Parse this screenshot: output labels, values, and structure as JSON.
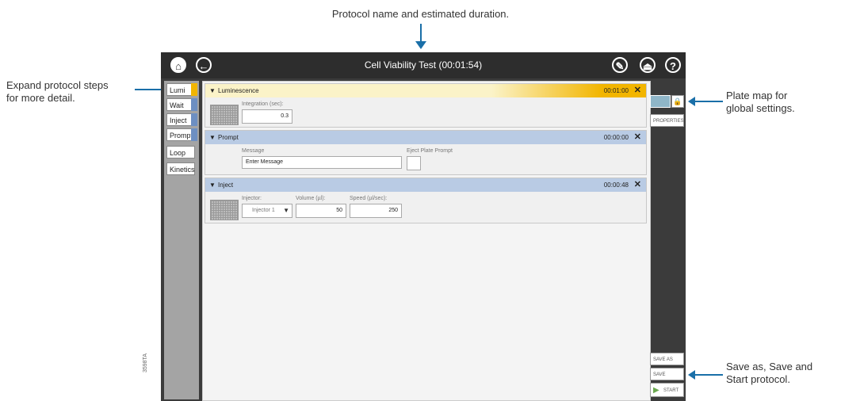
{
  "callouts": {
    "top": "Protocol name and estimated duration.",
    "left": "Expand protocol steps\nfor more detail.",
    "plate_map": "Plate map for\nglobal settings.",
    "save": "Save as, Save and\nStart protocol.",
    "figure_id": "3598TA"
  },
  "topbar": {
    "title": "Cell Viability Test (00:01:54)",
    "buttons": [
      "home-icon",
      "back-icon",
      "wrench-icon",
      "eject-icon",
      "help-icon"
    ]
  },
  "step_tabs": [
    "Lumi",
    "Wait",
    "Inject",
    "Prompt",
    "Loop",
    "Kinetics"
  ],
  "panels": {
    "luminescence": {
      "name": "Luminescence",
      "time": "00:01:00",
      "field_label": "Integration (sec):",
      "field_value": "0.3"
    },
    "prompt": {
      "name": "Prompt",
      "time": "00:00:00",
      "message_label": "Message",
      "message_value": "Enter Message",
      "eject_label": "Eject Plate Prompt"
    },
    "inject": {
      "name": "Inject",
      "time": "00:00:48",
      "injector_label": "Injector:",
      "injector_value": "Injector 1",
      "volume_label": "Volume (µl):",
      "volume_value": "50",
      "speed_label": "Speed (µl/sec):",
      "speed_value": "250"
    }
  },
  "right_panel": {
    "properties": "PROPERTIES",
    "save_as": "SAVE AS",
    "save": "SAVE",
    "start": "START"
  },
  "colors": {
    "lumi_header": "#f2b500",
    "step_header": "#b9cbe4",
    "accent_arrow": "#1a6fa8",
    "start_arrow": "#6aa84f"
  }
}
